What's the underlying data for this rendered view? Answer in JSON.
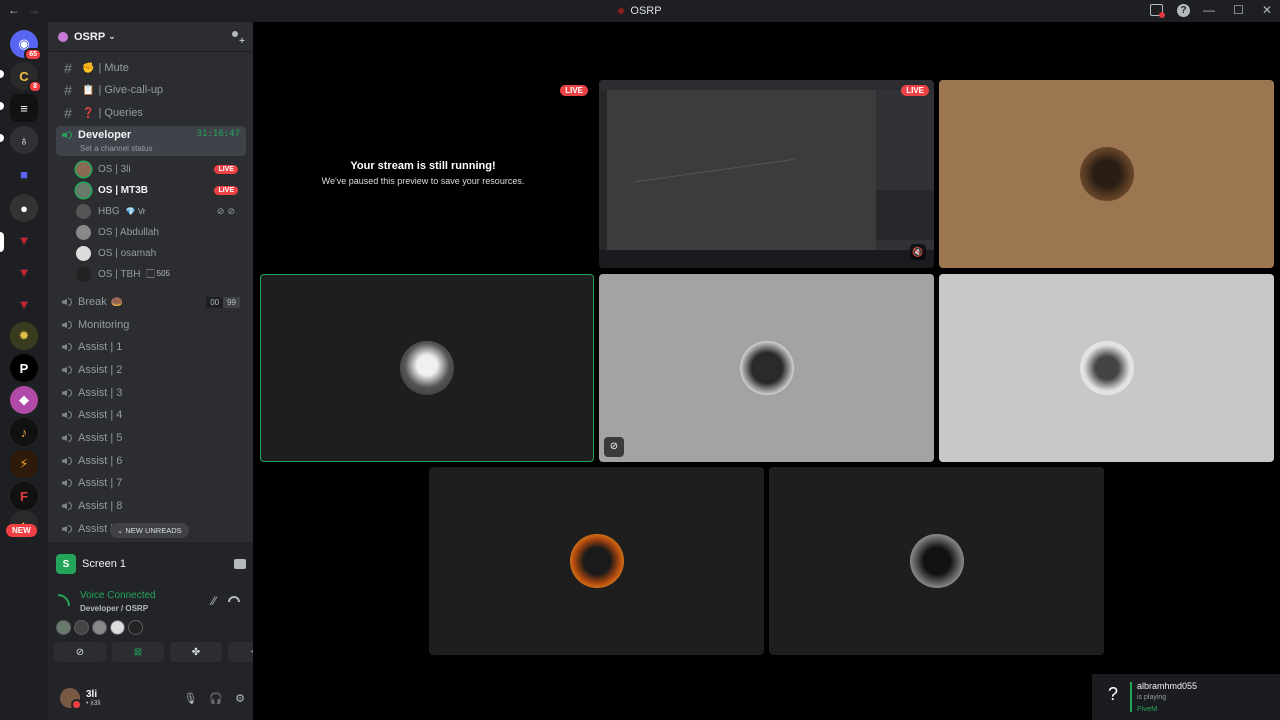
{
  "window": {
    "title": "OSRP",
    "nav_back": "←",
    "nav_forward": "→",
    "help": "?",
    "minimize": "—",
    "maximize": "☐",
    "close": "✕"
  },
  "guilds": {
    "home_badge": "65",
    "server2_badge": "8",
    "new_label": "NEW"
  },
  "server": {
    "name": "OSRP"
  },
  "channels": [
    {
      "name": "| Mute",
      "emoji": "✊"
    },
    {
      "name": "| Give-call-up",
      "emoji": "📋"
    },
    {
      "name": "| Queries",
      "emoji": "❓"
    }
  ],
  "active_channel": {
    "name": "Developer",
    "timer": "31:16:47",
    "status": "Set a channel status"
  },
  "voice_users": [
    {
      "name": "OS | 3li",
      "live": "LIVE"
    },
    {
      "name": "OS | MT3B",
      "live": "LIVE"
    },
    {
      "name": "HBG",
      "tag": "💎 Vr"
    },
    {
      "name": "OS | Abdullah"
    },
    {
      "name": "OS | osamah"
    },
    {
      "name": "OS | TBH",
      "tag": "🏻 505"
    }
  ],
  "voice_channels": [
    {
      "name": "Break",
      "emoji": "🍩",
      "count_a": "00",
      "count_b": "99"
    },
    {
      "name": "Monitoring"
    },
    {
      "name": "Assist | 1"
    },
    {
      "name": "Assist | 2"
    },
    {
      "name": "Assist | 3"
    },
    {
      "name": "Assist | 4"
    },
    {
      "name": "Assist | 5"
    },
    {
      "name": "Assist | 6"
    },
    {
      "name": "Assist | 7"
    },
    {
      "name": "Assist | 8"
    },
    {
      "name": "Assist |"
    }
  ],
  "new_unreads": "NEW UNREADS",
  "panel": {
    "screen_label": "Screen 1",
    "voice_connected": "Voice Connected",
    "voice_location": "Developer / OSRP",
    "username": "3li",
    "user_sub": "• ii3li"
  },
  "stage": {
    "paused_title": "Your stream is still running!",
    "paused_sub": "We've paused this preview to save your resources.",
    "live_badge": "LIVE"
  },
  "toast": {
    "icon": "?",
    "name": "albramhmd055",
    "status": "is playing",
    "game": "FiveM"
  },
  "colors": {
    "accent_green": "#23a55a",
    "live_red": "#ed4245",
    "sidebar_bg": "#2b2d31",
    "guild_bg": "#1e1f22"
  }
}
